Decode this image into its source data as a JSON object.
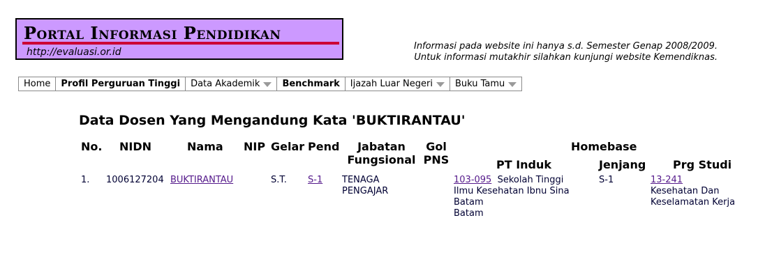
{
  "header": {
    "logo_title": "Portal Informasi Pendidikan",
    "logo_url": "http://evaluasi.or.id",
    "notice_line1": "Informasi pada website ini hanya s.d. Semester Genap 2008/2009.",
    "notice_line2": "Untuk informasi mutakhir silahkan kunjungi website Kemendiknas."
  },
  "menu": {
    "home": "Home",
    "profil": "Profil Perguruan Tinggi",
    "data_akademik": "Data Akademik",
    "benchmark": "Benchmark",
    "ijazah": "Ijazah Luar Negeri",
    "buku_tamu": "Buku Tamu"
  },
  "page": {
    "heading": "Data Dosen Yang Mengandung Kata 'BUKTIRANTAU'"
  },
  "table": {
    "headers": {
      "no": "No.",
      "nidn": "NIDN",
      "nama": "Nama",
      "nip": "NIP",
      "gelar": "Gelar",
      "pend": "Pend",
      "jabatan_1": "Jabatan",
      "jabatan_2": "Fungsional",
      "gol_1": "Gol",
      "gol_2": "PNS",
      "homebase": "Homebase",
      "pt_induk": "PT Induk",
      "jenjang": "Jenjang",
      "prg_studi": "Prg Studi"
    },
    "rows": [
      {
        "no": "1.",
        "nidn": "1006127204",
        "nama": "BUKTIRANTAU",
        "nip": "",
        "gelar": "S.T.",
        "pend": "S-1",
        "jabatan_1": "TENAGA",
        "jabatan_2": "PENGAJAR",
        "gol": "",
        "pt_code": "103-095",
        "pt_line1": "Sekolah Tinggi",
        "pt_line2": "Ilmu Kesehatan Ibnu Sina",
        "pt_line3": "Batam",
        "pt_line4": "Batam",
        "jenjang": "S-1",
        "prodi_code": "13-241",
        "prodi_line1": "Kesehatan Dan",
        "prodi_line2": "Keselamatan Kerja"
      }
    ]
  },
  "colors": {
    "logo_bg": "#cc99ff",
    "logo_bar": "#cc0033",
    "link": "#551a8b"
  }
}
